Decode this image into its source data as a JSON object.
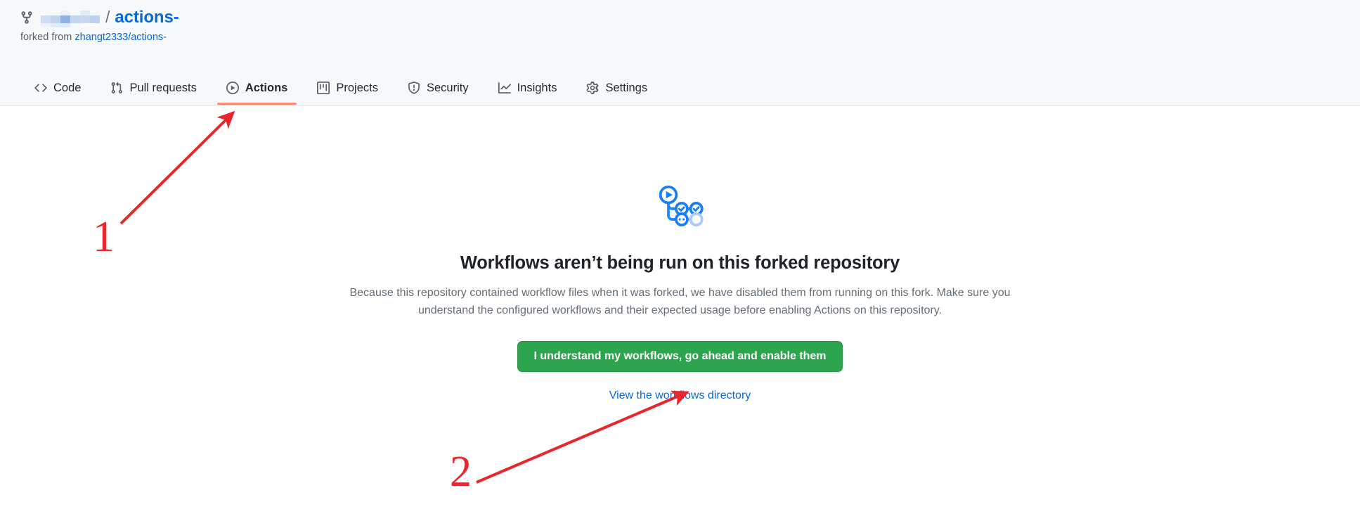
{
  "repo": {
    "fork_icon": "repo-forked-icon",
    "owner_name_redacted": true,
    "separator": "/",
    "name": "actions-",
    "forked_from_prefix": "forked from",
    "forked_from_link": "zhangt2333/actions-"
  },
  "nav": {
    "items": [
      {
        "id": "code",
        "label": "Code",
        "icon": "code-icon",
        "active": false
      },
      {
        "id": "pull-requests",
        "label": "Pull requests",
        "icon": "git-pull-request-icon",
        "active": false
      },
      {
        "id": "actions",
        "label": "Actions",
        "icon": "play-circle-icon",
        "active": true
      },
      {
        "id": "projects",
        "label": "Projects",
        "icon": "project-board-icon",
        "active": false
      },
      {
        "id": "security",
        "label": "Security",
        "icon": "shield-icon",
        "active": false
      },
      {
        "id": "insights",
        "label": "Insights",
        "icon": "graph-icon",
        "active": false
      },
      {
        "id": "settings",
        "label": "Settings",
        "icon": "gear-icon",
        "active": false
      }
    ],
    "active_underline_color": "#fd8c73"
  },
  "blankslate": {
    "icon": "actions-workflow-icon",
    "heading": "Workflows aren’t being run on this forked repository",
    "description": "Because this repository contained workflow files when it was forked, we have disabled them from running on this fork. Make sure you understand the configured workflows and their expected usage before enabling Actions on this repository.",
    "enable_button_label": "I understand my workflows, go ahead and enable them",
    "enable_button_color": "#2da44e",
    "view_directory_link": "View the workflows directory",
    "link_color": "#0969da"
  },
  "annotations": {
    "color": "#e8262b",
    "steps": [
      {
        "number": "1",
        "target": "actions-tab"
      },
      {
        "number": "2",
        "target": "enable-workflows-button"
      }
    ]
  }
}
